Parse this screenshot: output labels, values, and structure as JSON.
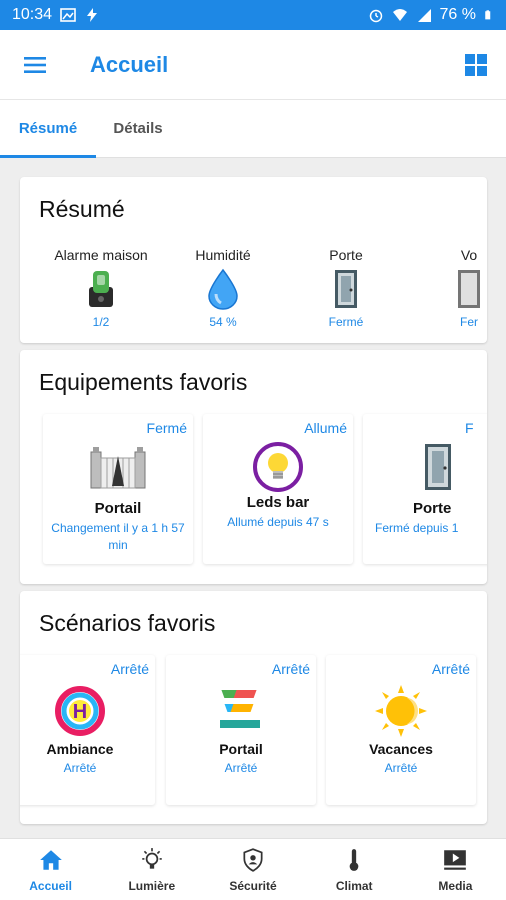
{
  "status": {
    "time": "10:34",
    "battery": "76 %"
  },
  "appbar": {
    "title": "Accueil"
  },
  "tabs": [
    {
      "label": "Résumé"
    },
    {
      "label": "Détails"
    }
  ],
  "summary": {
    "title": "Résumé",
    "items": [
      {
        "label": "Alarme maison",
        "value": "1/2",
        "icon": "alarm-icon"
      },
      {
        "label": "Humidité",
        "value": "54 %",
        "icon": "water-drop-icon"
      },
      {
        "label": "Porte",
        "value": "Fermé",
        "icon": "door-icon"
      },
      {
        "label": "Vo",
        "value": "Fer",
        "icon": "shutter-icon"
      }
    ]
  },
  "favorites": {
    "title": "Equipements favoris",
    "items": [
      {
        "state": "Fermé",
        "name": "Portail",
        "sub": "Changement il y a 1 h 57 min",
        "icon": "gate-icon"
      },
      {
        "state": "Allumé",
        "name": "Leds bar",
        "sub": "Allumé depuis 47 s",
        "icon": "bulb-icon"
      },
      {
        "state": "F",
        "name": "Porte",
        "sub": "Fermé depuis 1",
        "icon": "door-icon"
      }
    ]
  },
  "scenarios": {
    "title": "Scénarios favoris",
    "items": [
      {
        "state": "Arrêté",
        "name": "Ambiance",
        "sub": "Arrêté",
        "icon": "ambiance-icon"
      },
      {
        "state": "Arrêté",
        "name": "Portail",
        "sub": "Arrêté",
        "icon": "portail-scenario-icon"
      },
      {
        "state": "Arrêté",
        "name": "Vacances",
        "sub": "Arrêté",
        "icon": "sun-icon"
      }
    ]
  },
  "bottomnav": [
    {
      "label": "Accueil",
      "icon": "home-icon"
    },
    {
      "label": "Lumière",
      "icon": "lightbulb-icon"
    },
    {
      "label": "Sécurité",
      "icon": "shield-icon"
    },
    {
      "label": "Climat",
      "icon": "thermometer-icon"
    },
    {
      "label": "Media",
      "icon": "media-icon"
    }
  ],
  "colors": {
    "accent": "#1e88e5"
  }
}
